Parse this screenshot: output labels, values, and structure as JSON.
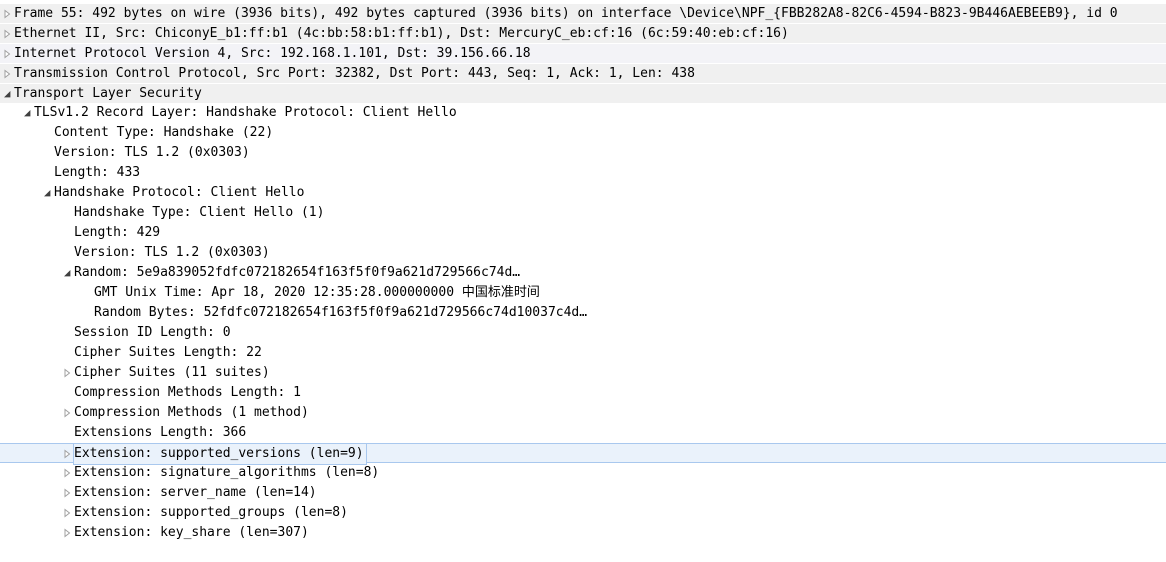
{
  "tree": [
    {
      "text": "Frame 55: 492 bytes on wire (3936 bits), 492 bytes captured (3936 bits) on interface \\Device\\NPF_{FBB282A8-82C6-4594-B823-9B446AEBEEB9}, id 0",
      "level": 0,
      "toggle": "collapsed",
      "icon": "chevron-right-icon"
    },
    {
      "text": "Ethernet II, Src: ChiconyE_b1:ff:b1 (4c:bb:58:b1:ff:b1), Dst: MercuryC_eb:cf:16 (6c:59:40:eb:cf:16)",
      "level": 0,
      "toggle": "collapsed",
      "icon": "chevron-right-icon"
    },
    {
      "text": "Internet Protocol Version 4, Src: 192.168.1.101, Dst: 39.156.66.18",
      "level": 0,
      "toggle": "collapsed",
      "icon": "chevron-right-icon"
    },
    {
      "text": "Transmission Control Protocol, Src Port: 32382, Dst Port: 443, Seq: 1, Ack: 1, Len: 438",
      "level": 0,
      "toggle": "collapsed",
      "icon": "chevron-right-icon"
    },
    {
      "text": "Transport Layer Security",
      "level": 0,
      "toggle": "expanded",
      "icon": "chevron-down-icon"
    },
    {
      "text": "TLSv1.2 Record Layer: Handshake Protocol: Client Hello",
      "level": 1,
      "toggle": "expanded",
      "icon": "chevron-down-icon"
    },
    {
      "text": "Content Type: Handshake (22)",
      "level": 2,
      "toggle": "none"
    },
    {
      "text": "Version: TLS 1.2 (0x0303)",
      "level": 2,
      "toggle": "none"
    },
    {
      "text": "Length: 433",
      "level": 2,
      "toggle": "none"
    },
    {
      "text": "Handshake Protocol: Client Hello",
      "level": 2,
      "toggle": "expanded",
      "icon": "chevron-down-icon"
    },
    {
      "text": "Handshake Type: Client Hello (1)",
      "level": 3,
      "toggle": "none"
    },
    {
      "text": "Length: 429",
      "level": 3,
      "toggle": "none"
    },
    {
      "text": "Version: TLS 1.2 (0x0303)",
      "level": 3,
      "toggle": "none"
    },
    {
      "text": "Random: 5e9a839052fdfc072182654f163f5f0f9a621d729566c74d…",
      "level": 3,
      "toggle": "expanded",
      "icon": "chevron-down-icon"
    },
    {
      "text": "GMT Unix Time: Apr 18, 2020 12:35:28.000000000 中国标准时间",
      "level": 4,
      "toggle": "none"
    },
    {
      "text": "Random Bytes: 52fdfc072182654f163f5f0f9a621d729566c74d10037c4d…",
      "level": 4,
      "toggle": "none"
    },
    {
      "text": "Session ID Length: 0",
      "level": 3,
      "toggle": "none"
    },
    {
      "text": "Cipher Suites Length: 22",
      "level": 3,
      "toggle": "none"
    },
    {
      "text": "Cipher Suites (11 suites)",
      "level": 3,
      "toggle": "collapsed",
      "icon": "chevron-right-icon"
    },
    {
      "text": "Compression Methods Length: 1",
      "level": 3,
      "toggle": "none"
    },
    {
      "text": "Compression Methods (1 method)",
      "level": 3,
      "toggle": "collapsed",
      "icon": "chevron-right-icon"
    },
    {
      "text": "Extensions Length: 366",
      "level": 3,
      "toggle": "none"
    },
    {
      "text": "Extension: supported_versions (len=9)",
      "level": 3,
      "toggle": "collapsed",
      "icon": "chevron-right-icon",
      "selected": true
    },
    {
      "text": "Extension: signature_algorithms (len=8)",
      "level": 3,
      "toggle": "collapsed",
      "icon": "chevron-right-icon"
    },
    {
      "text": "Extension: server_name (len=14)",
      "level": 3,
      "toggle": "collapsed",
      "icon": "chevron-right-icon"
    },
    {
      "text": "Extension: supported_groups (len=8)",
      "level": 3,
      "toggle": "collapsed",
      "icon": "chevron-right-icon"
    },
    {
      "text": "Extension: key_share (len=307)",
      "level": 3,
      "toggle": "collapsed",
      "icon": "chevron-right-icon"
    }
  ],
  "colors": {
    "top_level_bg": "#f0f0f0",
    "selection_bg": "#eaf2fb",
    "selection_border": "#a9c8ee",
    "toggle_collapsed": "#a0a0a0",
    "toggle_expanded": "#404040"
  }
}
